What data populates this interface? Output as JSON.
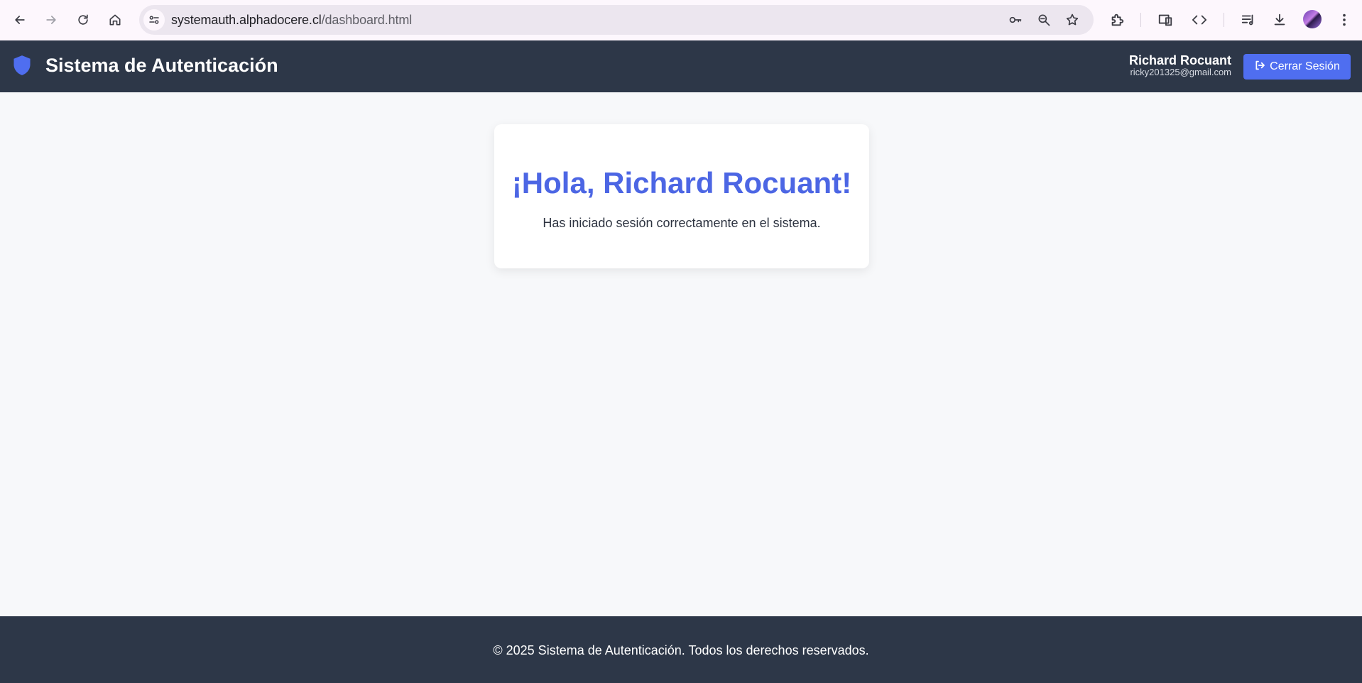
{
  "browser": {
    "url_host": "systemauth.alphadocere.cl",
    "url_path": "/dashboard.html",
    "icons": [
      "back-icon",
      "forward-icon",
      "reload-icon",
      "home-icon",
      "site-info-icon",
      "password-key-icon",
      "zoom-icon",
      "bookmark-star-icon",
      "extensions-icon",
      "device-icon",
      "code-icon",
      "media-queue-icon",
      "download-icon",
      "profile-avatar",
      "menu-icon"
    ]
  },
  "header": {
    "title": "Sistema de Autenticación",
    "user_name": "Richard Rocuant",
    "user_email": "ricky201325@gmail.com",
    "logout_label": "Cerrar Sesión",
    "accent_color": "#4f6ef0",
    "background_color": "#2d3748"
  },
  "main": {
    "greeting": "¡Hola, Richard Rocuant!",
    "message": "Has iniciado sesión correctamente en el sistema."
  },
  "footer": {
    "text": "© 2025 Sistema de Autenticación. Todos los derechos reservados."
  }
}
